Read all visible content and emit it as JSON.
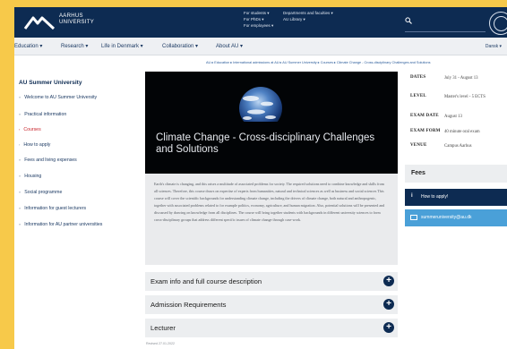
{
  "brand": {
    "line1": "AARHUS",
    "line2": "UNIVERSITY"
  },
  "topnav": {
    "col1": [
      "For students ▾",
      "For PhDs ▾",
      "For employees ▾"
    ],
    "col2": [
      "Departments and faculties ▾",
      "AU Library ▾"
    ]
  },
  "mainnav": {
    "items": [
      "Education ▾",
      "Research ▾",
      "Life in Denmark ▾",
      "Collaboration ▾",
      "About AU ▾"
    ],
    "language": "Dansk ▾"
  },
  "breadcrumb": "AU  ▸  Education  ▸  International admissions at AU  ▸  AU Summer University  ▸  Courses  ▸  Climate Change - Cross-disciplinary Challenges and Solutions",
  "sidebar": {
    "title": "AU Summer University",
    "items": [
      {
        "label": "Welcome to AU Summer University",
        "active": false
      },
      {
        "label": "Practical information",
        "active": false
      },
      {
        "label": "Courses",
        "active": true
      },
      {
        "label": "How to apply",
        "active": false
      },
      {
        "label": "Fees and living expenses",
        "active": false
      },
      {
        "label": "Housing",
        "active": false
      },
      {
        "label": "Social programme",
        "active": false
      },
      {
        "label": "Information for guest lecturers",
        "active": false
      },
      {
        "label": "Information for AU partner universities",
        "active": false
      }
    ]
  },
  "hero": {
    "title": "Climate Change - Cross-disciplinary Challenges and Solutions"
  },
  "description": "Earth's climate is changing, and this raises a multitude of associated problems for society. The required solutions need to combine knowledge and skills from all sciences. Therefore, this course draws on expertise of experts from humanities, natural and technical sciences as well as business and social sciences This course will cover the scientific backgrounds for understanding climate change, including the drivers of climate change, both natural and anthropogenic, together with associated problems related to for example politics, economy, agriculture, and human migration. Also, potential solutions will be presented and discussed by drawing on knowledge from all disciplines. The course will bring together students with backgrounds in different university sciences to form cross-disciplinary groups that address different specific issues of climate change through case-work.",
  "accordions": [
    "Exam info and full course description",
    "Admission Requirements",
    "Lecturer"
  ],
  "revised": "Revised 27.01.2022",
  "facts": [
    {
      "label": "DATES",
      "value": "July 31 - August 13"
    },
    {
      "label": "LEVEL",
      "value": "Master's level - 5 ECTS"
    },
    {
      "label": "EXAM DATE",
      "value": "August 13"
    },
    {
      "label": "EXAM FORM",
      "value": "40 minute oral exam"
    },
    {
      "label": "VENUE",
      "value": "Campus Aarhus"
    }
  ],
  "fees": {
    "title": "Fees"
  },
  "apply": {
    "label": "How to apply!"
  },
  "contact": {
    "email": "summeruniversity@au.dk"
  },
  "colors": {
    "navy": "#0d2b52",
    "active": "#c8232b",
    "mail": "#4aa0d8",
    "outer": "#f7c94a"
  }
}
